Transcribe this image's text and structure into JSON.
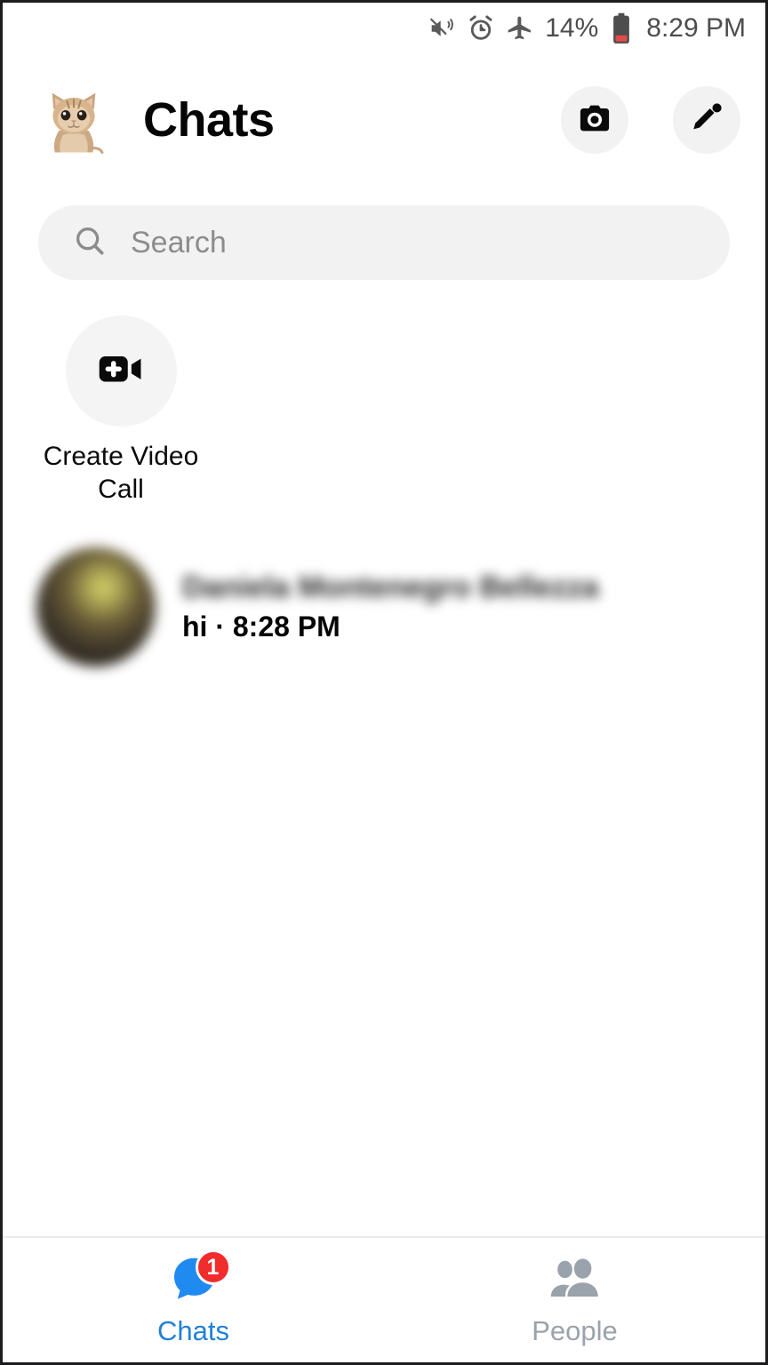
{
  "status_bar": {
    "icons": [
      "mute-vibrate-icon",
      "alarm-clock-icon",
      "airplane-mode-icon"
    ],
    "battery_percent": "14%",
    "battery_icon": "battery-low-icon",
    "time": "8:29 PM"
  },
  "header": {
    "avatar_icon": "cat-profile-avatar",
    "title": "Chats",
    "camera_icon": "camera-icon",
    "compose_icon": "pencil-compose-icon"
  },
  "search": {
    "icon": "search-icon",
    "placeholder": "Search",
    "value": ""
  },
  "shortcuts": [
    {
      "icon": "video-camera-plus-icon",
      "label": "Create Video Call"
    }
  ],
  "chats": [
    {
      "avatar_icon": "contact-avatar-blurred",
      "name": "Daniela Montenegro Bellezza",
      "snippet": "hi · 8:28 PM",
      "unread": true
    }
  ],
  "bottom_nav": {
    "tabs": [
      {
        "label": "Chats",
        "icon": "chat-bubble-icon",
        "badge": "1",
        "active": true
      },
      {
        "label": "People",
        "icon": "people-icon",
        "badge": "",
        "active": false
      }
    ]
  },
  "colors": {
    "accent_blue": "#2281d6",
    "icon_blue": "#1f8af0",
    "badge_red": "#f02c2c",
    "inactive_gray": "#9aa3ab",
    "field_gray": "#f2f2f2",
    "text_primary": "#050505",
    "placeholder_gray": "#8c8c8c"
  }
}
